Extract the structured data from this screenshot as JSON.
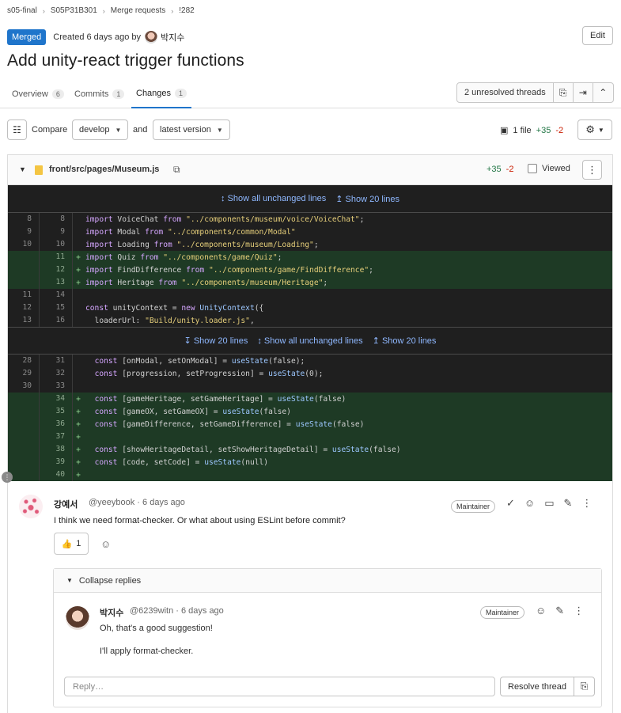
{
  "breadcrumb": [
    "s05-final",
    "S05P31B301",
    "Merge requests",
    "!282"
  ],
  "header": {
    "status_badge": "Merged",
    "created_text": "Created 6 days ago by",
    "author": "박지수",
    "edit_label": "Edit",
    "title": "Add unity-react trigger functions"
  },
  "tabs": [
    {
      "label": "Overview",
      "count": "6"
    },
    {
      "label": "Commits",
      "count": "1"
    },
    {
      "label": "Changes",
      "count": "1"
    }
  ],
  "threads": {
    "label": "2 unresolved threads"
  },
  "compare": {
    "label": "Compare",
    "base": "develop",
    "and_label": "and",
    "version": "latest version",
    "files": "1 file",
    "additions": "+35",
    "deletions": "-2"
  },
  "file": {
    "path": "front/src/pages/Museum.js",
    "additions": "+35",
    "deletions": "-2",
    "viewed_label": "Viewed"
  },
  "expanders": {
    "top": [
      "Show all unchanged lines",
      "Show 20 lines"
    ],
    "middle": [
      "Show 20 lines",
      "Show all unchanged lines",
      "Show 20 lines"
    ]
  },
  "diff_block1": [
    {
      "old": "8",
      "new": "8",
      "prefix": "",
      "type": "ctx",
      "code": "import VoiceChat from \"../components/museum/voice/VoiceChat\";"
    },
    {
      "old": "9",
      "new": "9",
      "prefix": "",
      "type": "ctx",
      "code": "import Modal from \"../components/common/Modal\""
    },
    {
      "old": "10",
      "new": "10",
      "prefix": "",
      "type": "ctx",
      "code": "import Loading from \"../components/museum/Loading\";"
    },
    {
      "old": "",
      "new": "11",
      "prefix": "+",
      "type": "add",
      "code": "import Quiz from \"../components/game/Quiz\";"
    },
    {
      "old": "",
      "new": "12",
      "prefix": "+",
      "type": "add",
      "code": "import FindDifference from \"../components/game/FindDifference\";"
    },
    {
      "old": "",
      "new": "13",
      "prefix": "+",
      "type": "add",
      "code": "import Heritage from \"../components/museum/Heritage\";"
    },
    {
      "old": "11",
      "new": "14",
      "prefix": "",
      "type": "ctx",
      "code": ""
    },
    {
      "old": "12",
      "new": "15",
      "prefix": "",
      "type": "ctx",
      "code": "const unityContext = new UnityContext({"
    },
    {
      "old": "13",
      "new": "16",
      "prefix": "",
      "type": "ctx",
      "code": "  loaderUrl: \"Build/unity.loader.js\","
    }
  ],
  "diff_block2": [
    {
      "old": "28",
      "new": "31",
      "prefix": "",
      "type": "ctx",
      "code": "  const [onModal, setOnModal] = useState(false);"
    },
    {
      "old": "29",
      "new": "32",
      "prefix": "",
      "type": "ctx",
      "code": "  const [progression, setProgression] = useState(0);"
    },
    {
      "old": "30",
      "new": "33",
      "prefix": "",
      "type": "ctx",
      "code": ""
    },
    {
      "old": "",
      "new": "34",
      "prefix": "+",
      "type": "add",
      "code": "  const [gameHeritage, setGameHeritage] = useState(false)"
    },
    {
      "old": "",
      "new": "35",
      "prefix": "+",
      "type": "add",
      "code": "  const [gameOX, setGameOX] = useState(false)"
    },
    {
      "old": "",
      "new": "36",
      "prefix": "+",
      "type": "add",
      "code": "  const [gameDifference, setGameDifference] = useState(false)"
    },
    {
      "old": "",
      "new": "37",
      "prefix": "+",
      "type": "add",
      "code": ""
    },
    {
      "old": "",
      "new": "38",
      "prefix": "+",
      "type": "add",
      "code": "  const [showHeritageDetail, setShowHeritageDetail] = useState(false)"
    },
    {
      "old": "",
      "new": "39",
      "prefix": "+",
      "type": "add",
      "code": "  const [code, setCode] = useState(null)"
    },
    {
      "old": "",
      "new": "40",
      "prefix": "+",
      "type": "add",
      "code": ""
    }
  ],
  "comment": {
    "author": "강예서",
    "meta": "@yeeybook · 6 days ago",
    "role": "Maintainer",
    "body": "I think we need format-checker. Or what about using ESLint before commit?",
    "reaction_count": "1"
  },
  "replies": {
    "collapse_label": "Collapse replies",
    "author": "박지수",
    "meta": "@6239witn · 6 days ago",
    "role": "Maintainer",
    "body1": "Oh, that's a good suggestion!",
    "body2": "I'll apply format-checker.",
    "reply_placeholder": "Reply…",
    "resolve_label": "Resolve thread"
  }
}
